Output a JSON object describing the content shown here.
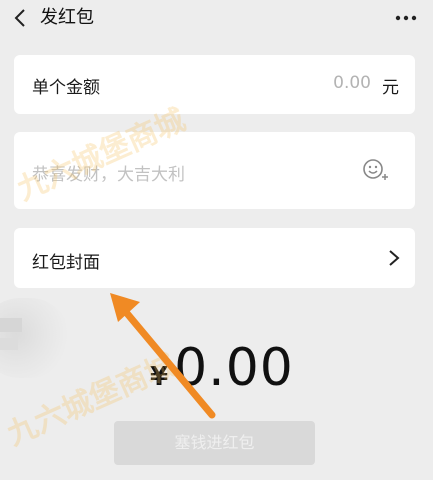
{
  "header": {
    "title": "发红包",
    "back_icon": "chevron-left-icon",
    "more_icon": "more-dots-icon"
  },
  "amount_row": {
    "label": "单个金额",
    "value": "0.00",
    "unit": "元"
  },
  "message_row": {
    "placeholder": "恭喜发财，大吉大利",
    "icon": "emoji-add-icon"
  },
  "cover_row": {
    "label": "红包封面",
    "icon": "chevron-right-icon"
  },
  "total": {
    "currency": "¥",
    "value": "0.00"
  },
  "submit": {
    "label": "塞钱进红包"
  },
  "watermark": {
    "text": "九六城堡商城"
  },
  "annotation": {
    "arrow_color": "#f08a24"
  }
}
